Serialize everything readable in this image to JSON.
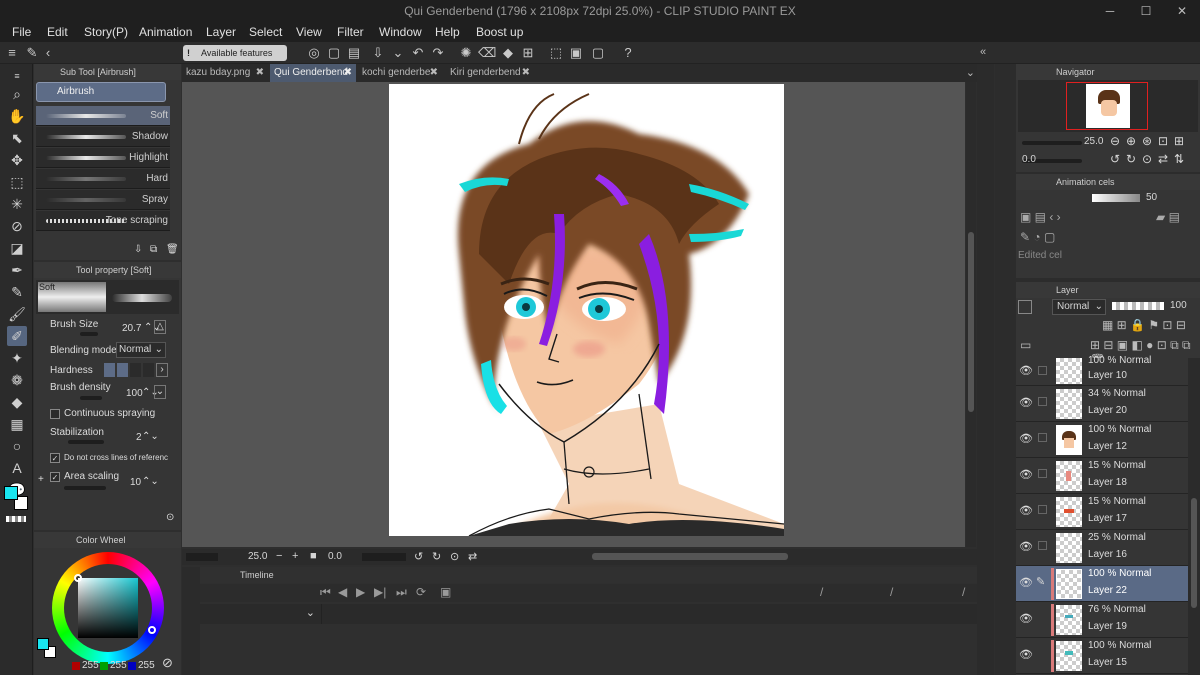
{
  "window": {
    "title": "Qui Genderbend (1796 x 2108px 72dpi 25.0%) - CLIP STUDIO PAINT EX"
  },
  "menu": [
    "File",
    "Edit",
    "Story(P)",
    "Animation",
    "Layer",
    "Select",
    "View",
    "Filter",
    "Window",
    "Help",
    "Boost up"
  ],
  "command_bar": {
    "available_features": "Available features"
  },
  "sub_tool": {
    "header": "Sub Tool [Airbrush]",
    "group": "Airbrush",
    "brushes": [
      "Soft",
      "Shadow",
      "Highlight",
      "Hard",
      "Spray",
      "Tone scraping"
    ]
  },
  "tool_property": {
    "header": "Tool property [Soft]",
    "preview_label": "Soft",
    "brush_size_label": "Brush Size",
    "brush_size": "20.7",
    "blending_label": "Blending mode",
    "blending": "Normal",
    "hardness_label": "Hardness",
    "density_label": "Brush density",
    "density": "100",
    "continuous_label": "Continuous spraying",
    "stabilization_label": "Stabilization",
    "stabilization": "2",
    "cross_label": "Do not cross lines of reference la",
    "area_label": "Area scaling",
    "area": "10"
  },
  "color_wheel": {
    "header": "Color Wheel",
    "r": "255",
    "g": "255",
    "b": "255",
    "main_color": "#19e6f0",
    "sub_color": "#ffffff"
  },
  "tabs": [
    "kazu bday.png",
    "Qui Genderbend",
    "kochi genderbe",
    "Kiri genderbend"
  ],
  "canvas_status": {
    "zoom": "25.0",
    "angle": "0.0"
  },
  "timeline": {
    "header": "Timeline"
  },
  "navigator": {
    "header": "Navigator",
    "zoom": "25.0",
    "angle": "0.0"
  },
  "animation_cels": {
    "header": "Animation cels",
    "opacity": "50",
    "edited_cel": "Edited cel"
  },
  "layer_panel": {
    "header": "Layer",
    "blend": "Normal",
    "opacity": "100",
    "layers": [
      {
        "mode": "100 % Normal",
        "name": "Layer 10"
      },
      {
        "mode": "34 % Normal",
        "name": "Layer 20"
      },
      {
        "mode": "100 % Normal",
        "name": "Layer 12"
      },
      {
        "mode": "15 % Normal",
        "name": "Layer 18"
      },
      {
        "mode": "15 % Normal",
        "name": "Layer 17"
      },
      {
        "mode": "25 % Normal",
        "name": "Layer 16"
      },
      {
        "mode": "100 % Normal",
        "name": "Layer 22"
      },
      {
        "mode": "76 % Normal",
        "name": "Layer 19"
      },
      {
        "mode": "100 % Normal",
        "name": "Layer 15"
      }
    ]
  }
}
